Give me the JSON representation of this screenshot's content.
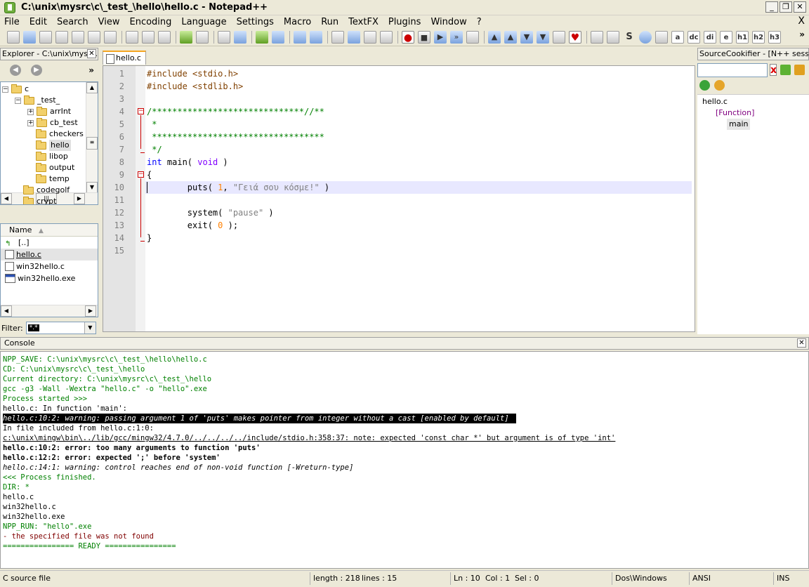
{
  "window": {
    "title": "C:\\unix\\mysrc\\c\\_test_\\hello\\hello.c - Notepad++",
    "minimize": "_",
    "maximize": "❐",
    "close": "✕"
  },
  "menu": [
    "File",
    "Edit",
    "Search",
    "View",
    "Encoding",
    "Language",
    "Settings",
    "Macro",
    "Run",
    "TextFX",
    "Plugins",
    "Window",
    "?"
  ],
  "menu_close": "X",
  "toolbar": {
    "more": "»",
    "s_label": "S",
    "text_buttons": [
      "a",
      "dc",
      "di",
      "e",
      "h1",
      "h2",
      "h3"
    ]
  },
  "explorer": {
    "title": "Explorer - C:\\unix\\mysr...",
    "nav_more": "»",
    "tree": [
      {
        "label": "c",
        "depth": 0,
        "expanded": true
      },
      {
        "label": "_test_",
        "depth": 1,
        "expanded": true
      },
      {
        "label": "arrInt",
        "depth": 2,
        "expander": "+"
      },
      {
        "label": "cb_test",
        "depth": 2,
        "expander": "+"
      },
      {
        "label": "checkers",
        "depth": 2
      },
      {
        "label": "hello",
        "depth": 2,
        "selected": true
      },
      {
        "label": "libop",
        "depth": 2
      },
      {
        "label": "output",
        "depth": 2
      },
      {
        "label": "temp",
        "depth": 2
      },
      {
        "label": "codegolf",
        "depth": 1
      },
      {
        "label": "crypt",
        "depth": 1
      }
    ],
    "list_header": "Name",
    "files": [
      {
        "label": "[..]",
        "kind": "up"
      },
      {
        "label": "hello.c",
        "kind": "c",
        "selected": true
      },
      {
        "label": "win32hello.c",
        "kind": "c"
      },
      {
        "label": "win32hello.exe",
        "kind": "exe"
      }
    ],
    "filter_label": "Filter:",
    "filter_value": "*.*"
  },
  "editor": {
    "tab_label": "hello.c",
    "lines": [
      {
        "n": "1",
        "parts": [
          [
            "c-pre",
            "#include <stdio.h>"
          ]
        ]
      },
      {
        "n": "2",
        "parts": [
          [
            "c-pre",
            "#include <stdlib.h>"
          ]
        ]
      },
      {
        "n": "3",
        "parts": []
      },
      {
        "n": "4",
        "parts": [
          [
            "c-com",
            "/******************************//**"
          ]
        ]
      },
      {
        "n": "5",
        "parts": [
          [
            "c-com",
            " *"
          ]
        ]
      },
      {
        "n": "6",
        "parts": [
          [
            "c-com",
            " **********************************"
          ]
        ]
      },
      {
        "n": "7",
        "parts": [
          [
            "c-com",
            " */"
          ]
        ]
      },
      {
        "n": "8",
        "parts": [
          [
            "c-kw",
            "int"
          ],
          [
            "",
            " main( "
          ],
          [
            "c-type",
            "void"
          ],
          [
            "",
            " )"
          ]
        ]
      },
      {
        "n": "9",
        "parts": [
          [
            "",
            "{"
          ]
        ]
      },
      {
        "n": "10",
        "parts": [
          [
            "",
            "        puts( "
          ],
          [
            "c-num",
            "1"
          ],
          [
            "",
            ", "
          ],
          [
            "c-str",
            "\"Γειά σου κόσμε!\""
          ],
          [
            "",
            " )"
          ]
        ]
      },
      {
        "n": "11",
        "parts": []
      },
      {
        "n": "12",
        "parts": [
          [
            "",
            "        system( "
          ],
          [
            "c-str",
            "\"pause\""
          ],
          [
            "",
            " )"
          ]
        ]
      },
      {
        "n": "13",
        "parts": [
          [
            "",
            "        exit( "
          ],
          [
            "c-num",
            "0"
          ],
          [
            "",
            " );"
          ]
        ]
      },
      {
        "n": "14",
        "parts": [
          [
            "",
            "}"
          ]
        ]
      },
      {
        "n": "15",
        "parts": []
      }
    ],
    "current_line": 10,
    "fold_open": "−"
  },
  "cookifier": {
    "title": "SourceCookifier - [N++ sess...",
    "clear": "x",
    "file": "hello.c",
    "group": "[Function]",
    "func": "main"
  },
  "console": {
    "title": "Console",
    "lines": [
      {
        "cls": "cl-green",
        "text": "NPP_SAVE: C:\\unix\\mysrc\\c\\_test_\\hello\\hello.c"
      },
      {
        "cls": "cl-green",
        "text": "CD: C:\\unix\\mysrc\\c\\_test_\\hello"
      },
      {
        "cls": "cl-green",
        "text": "Current directory: C:\\unix\\mysrc\\c\\_test_\\hello"
      },
      {
        "cls": "cl-green",
        "text": "gcc -g3 -Wall -Wextra \"hello.c\" -o \"hello\".exe"
      },
      {
        "cls": "cl-green",
        "text": "Process started >>>"
      },
      {
        "cls": "cl-black",
        "text": "hello.c: In function 'main':"
      },
      {
        "cls": "cl-inv",
        "text": "hello.c:10:2: warning: passing argument 1 of 'puts' makes pointer from integer without a cast [enabled by default]"
      },
      {
        "cls": "cl-black",
        "text": "In file included from hello.c:1:0:"
      },
      {
        "cls": "cl-black cl-ul",
        "text": "c:\\unix\\mingw\\bin\\../lib/gcc/mingw32/4.7.0/../../../../include/stdio.h:358:37: note: expected 'const char *' but argument is of type 'int'"
      },
      {
        "cls": "cl-bold",
        "text": "hello.c:10:2: error: too many arguments to function 'puts'"
      },
      {
        "cls": "cl-bold",
        "text": "hello.c:12:2: error: expected ';' before 'system'"
      },
      {
        "cls": "cl-ital",
        "text": "hello.c:14:1: warning: control reaches end of non-void function [-Wreturn-type]"
      },
      {
        "cls": "cl-green",
        "text": "<<< Process finished."
      },
      {
        "cls": "cl-green",
        "text": "DIR: *"
      },
      {
        "cls": "cl-black",
        "text": "hello.c"
      },
      {
        "cls": "cl-black",
        "text": "win32hello.c"
      },
      {
        "cls": "cl-black",
        "text": "win32hello.exe"
      },
      {
        "cls": "cl-green",
        "text": "NPP_RUN: \"hello\".exe"
      },
      {
        "cls": "cl-red",
        "text": "- the specified file was not found"
      },
      {
        "cls": "cl-green",
        "text": "================ READY ================"
      }
    ]
  },
  "status": {
    "filetype": "C source file",
    "length": "length : 218",
    "lines": "lines : 15",
    "ln": "Ln : 10",
    "col": "Col : 1",
    "sel": "Sel : 0",
    "eol": "Dos\\Windows",
    "encoding": "ANSI",
    "mode": "INS"
  }
}
